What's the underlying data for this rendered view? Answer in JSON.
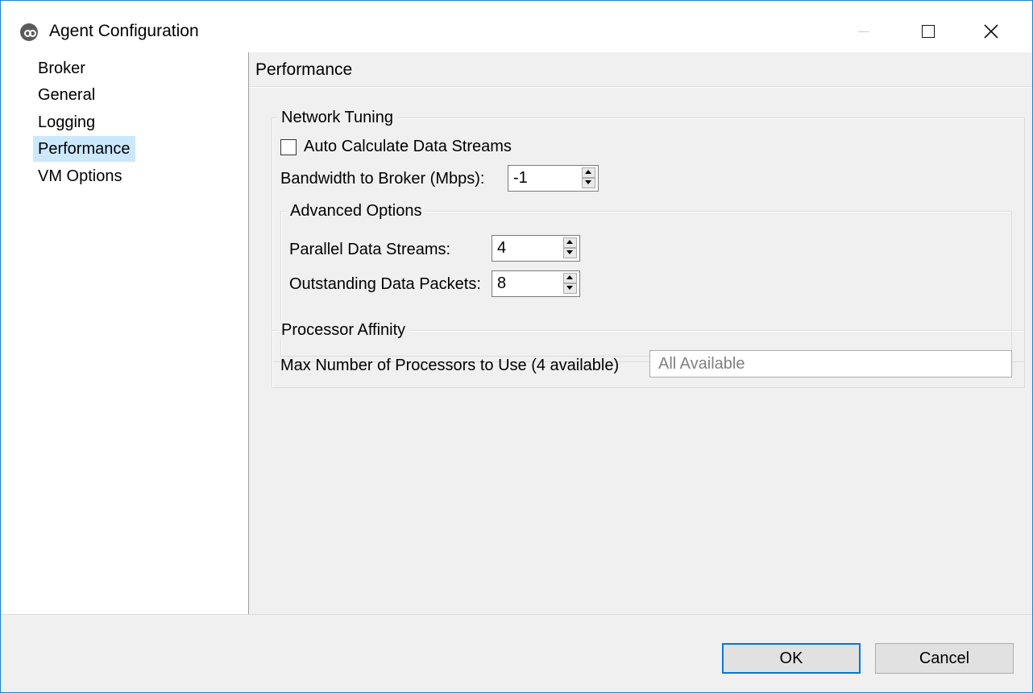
{
  "window": {
    "title": "Agent Configuration",
    "icon": "app-logo-icon",
    "controls": [
      "minimize-icon",
      "maximize-icon",
      "close-icon"
    ]
  },
  "sidebar": {
    "items": [
      {
        "label": "Broker",
        "selected": false
      },
      {
        "label": "General",
        "selected": false
      },
      {
        "label": "Logging",
        "selected": false
      },
      {
        "label": "Performance",
        "selected": true
      },
      {
        "label": "VM Options",
        "selected": false
      }
    ]
  },
  "content": {
    "title": "Performance",
    "network_tuning": {
      "legend": "Network Tuning",
      "auto_calculate": {
        "label": "Auto Calculate Data Streams",
        "checked": false
      },
      "bandwidth": {
        "label": "Bandwidth to Broker (Mbps):",
        "value": "-1"
      },
      "advanced": {
        "legend": "Advanced Options",
        "parallel_streams": {
          "label": "Parallel Data Streams:",
          "value": "4"
        },
        "outstanding_packets": {
          "label": "Outstanding Data Packets:",
          "value": "8"
        }
      }
    },
    "processor_affinity": {
      "legend": "Processor Affinity",
      "max_processors": {
        "label": "Max Number of Processors to Use (4 available)",
        "placeholder": "All Available"
      }
    }
  },
  "footer": {
    "ok_label": "OK",
    "cancel_label": "Cancel"
  },
  "colors": {
    "window_border": "#1883d7",
    "selection": "#cce8ff",
    "panel_bg": "#f0f0f0",
    "default_button_border": "#0078d7"
  }
}
